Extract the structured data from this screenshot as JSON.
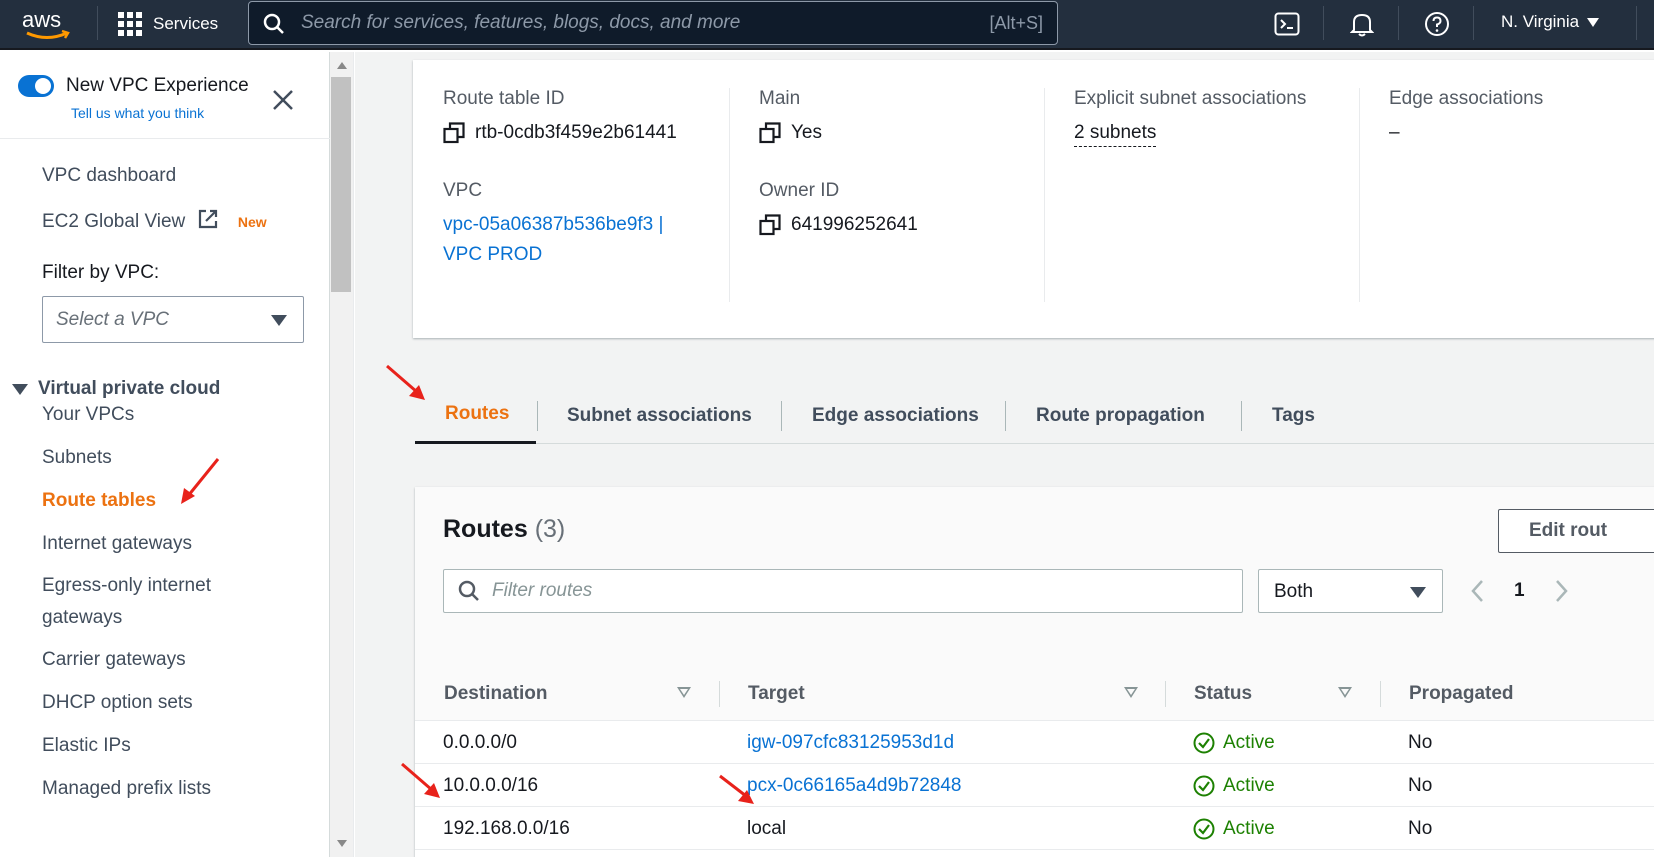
{
  "topnav": {
    "logo_text": "aws",
    "services_label": "Services",
    "search_placeholder": "Search for services, features, blogs, docs, and more",
    "search_shortcut": "[Alt+S]",
    "region_label": "N. Virginia"
  },
  "sidebar": {
    "experience_title": "New VPC Experience",
    "experience_feedback": "Tell us what you think",
    "links": {
      "dashboard": "VPC dashboard",
      "ec2_global": "EC2 Global View",
      "ec2_global_badge": "New"
    },
    "filter_label": "Filter by VPC:",
    "filter_placeholder": "Select a VPC",
    "section_title": "Virtual private cloud",
    "items": [
      "Your VPCs",
      "Subnets",
      "Route tables",
      "Internet gateways",
      "Egress-only internet",
      "gateways",
      "Carrier gateways",
      "DHCP option sets",
      "Elastic IPs",
      "Managed prefix lists"
    ],
    "active_item": "Route tables"
  },
  "details": {
    "route_table_id_label": "Route table ID",
    "route_table_id": "rtb-0cdb3f459e2b61441",
    "vpc_label": "VPC",
    "vpc_value_line1": "vpc-05a06387b536be9f3 |",
    "vpc_value_line2": "VPC PROD",
    "main_label": "Main",
    "main_value": "Yes",
    "owner_label": "Owner ID",
    "owner_value": "641996252641",
    "explicit_label": "Explicit subnet associations",
    "explicit_value": "2 subnets",
    "edge_label": "Edge associations",
    "edge_value": "–"
  },
  "tabs": [
    "Routes",
    "Subnet associations",
    "Edge associations",
    "Route propagation",
    "Tags"
  ],
  "active_tab": "Routes",
  "routes": {
    "title": "Routes",
    "count": "(3)",
    "edit_button": "Edit rout",
    "filter_placeholder": "Filter routes",
    "filter_select": "Both",
    "page": "1",
    "columns": [
      "Destination",
      "Target",
      "Status",
      "Propagated"
    ],
    "rows": [
      {
        "destination": "0.0.0.0/0",
        "target": "igw-097cfc83125953d1d",
        "target_link": true,
        "status": "Active",
        "propagated": "No"
      },
      {
        "destination": "10.0.0.0/16",
        "target": "pcx-0c66165a4d9b72848",
        "target_link": true,
        "status": "Active",
        "propagated": "No"
      },
      {
        "destination": "192.168.0.0/16",
        "target": "local",
        "target_link": false,
        "status": "Active",
        "propagated": "No"
      }
    ]
  },
  "colors": {
    "nav_bg": "#232f3e",
    "accent_orange": "#ec7211",
    "link_blue": "#0972d3",
    "status_green": "#1d8102",
    "annotation_red": "#e8221b"
  }
}
